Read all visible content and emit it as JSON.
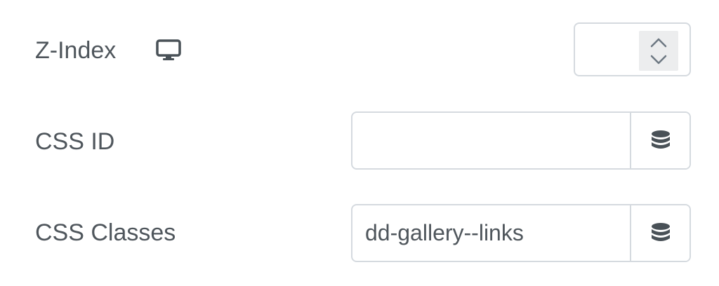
{
  "fields": {
    "z_index": {
      "label": "Z-Index",
      "value": "",
      "device_icon": "desktop-monitor-icon"
    },
    "css_id": {
      "label": "CSS ID",
      "value": "",
      "dynamic_icon": "database-icon"
    },
    "css_classes": {
      "label": "CSS Classes",
      "value": "dd-gallery--links",
      "dynamic_icon": "database-icon"
    }
  },
  "colors": {
    "label_text": "#4f565c",
    "border": "#d5dadf",
    "icon": "#495157",
    "spinner_bg": "#ecedee"
  }
}
